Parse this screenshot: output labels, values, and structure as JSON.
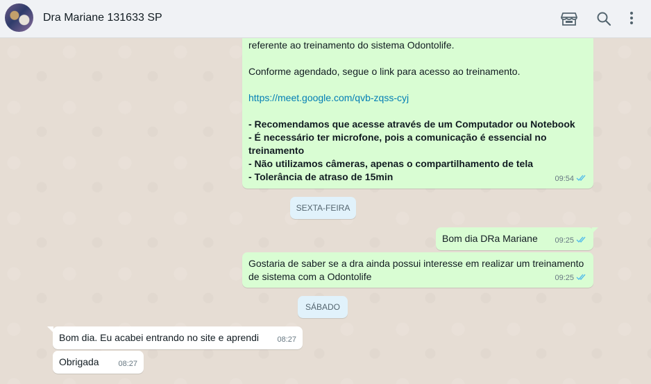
{
  "header": {
    "contact_name": "Dra Mariane 131633 SP",
    "icons": [
      "store-icon",
      "search-icon",
      "menu-icon"
    ]
  },
  "messages": {
    "m1": {
      "line1": "referente ao treinamento do sistema Odontolife.",
      "line2": "Conforme agendado, segue o link para acesso ao treinamento.",
      "link": "https://meet.google.com/qvb-zqss-cyj",
      "b1": "- Recomendamos que acesse através de um Computador ou Notebook",
      "b2a": "- É necessário ter microfone, pois a comunicação é essencial no",
      "b2b": "treinamento",
      "b3": "- Não utilizamos câmeras, apenas o compartilhamento de tela",
      "b4": "- Tolerância de atraso de 15min",
      "time": "09:54"
    },
    "date1": "SEXTA-FEIRA",
    "m2": {
      "text": "Bom dia DRa Mariane",
      "time": "09:25"
    },
    "m3": {
      "line1": "Gostaria de saber se a dra ainda possui interesse em realizar um treinamento",
      "line2": "de sistema com a Odontolife",
      "time": "09:25"
    },
    "date2": "SÁBADO",
    "m4": {
      "text": "Bom dia. Eu acabei entrando no site e aprendi",
      "time": "08:27"
    },
    "m5": {
      "text": "Obrigada",
      "time": "08:27"
    }
  },
  "colors": {
    "outgoing_bubble": "#d9fdd3",
    "incoming_bubble": "#ffffff",
    "date_chip": "#e1f2fb",
    "read_ticks": "#53bdeb",
    "link": "#027eb5"
  }
}
